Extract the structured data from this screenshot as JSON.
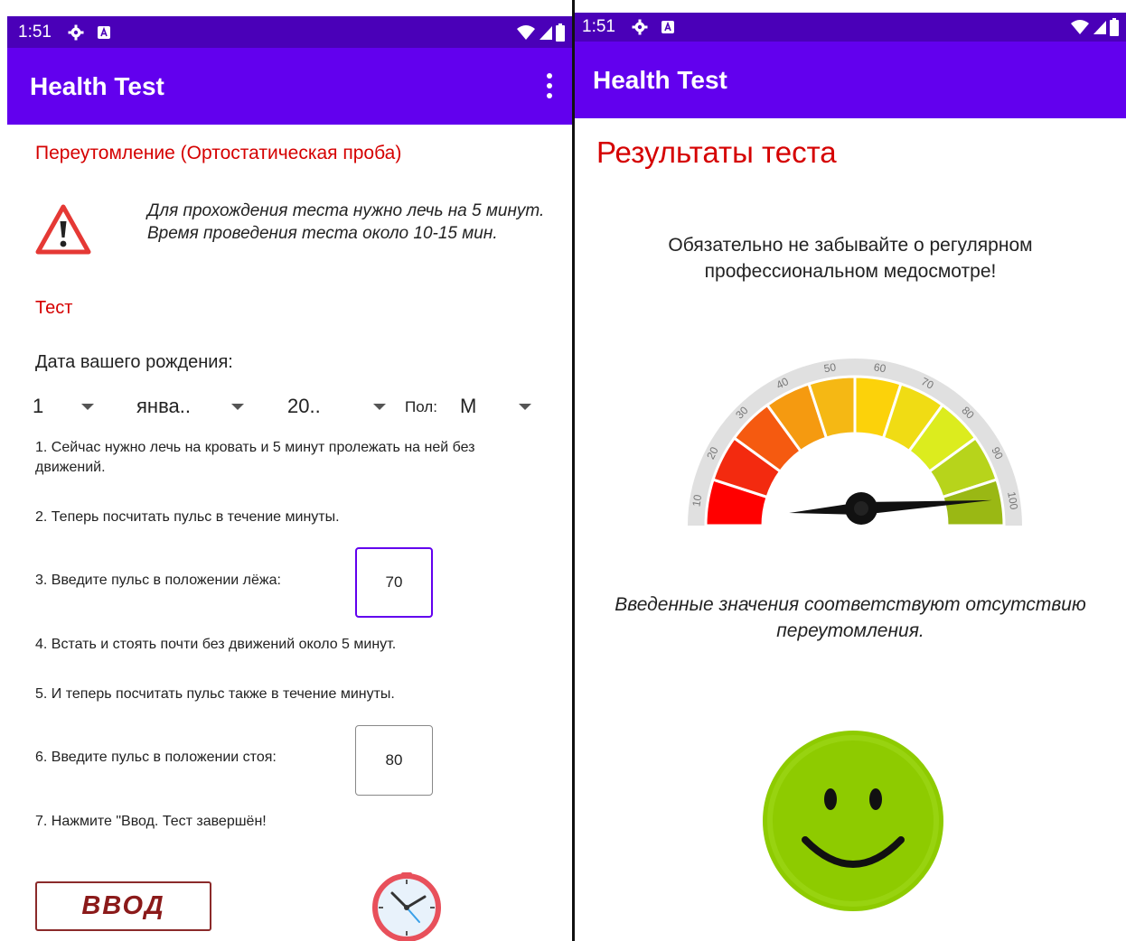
{
  "left_screen": {
    "status": {
      "time": "1:51"
    },
    "app_title": "Health Test",
    "test_title": "Переутомление (Ортостатическая проба)",
    "warning_text": "Для прохождения теста нужно лечь на 5 минут. Время проведения теста около 10-15 мин.",
    "section_label": "Тест",
    "dob_label": "Дата вашего рождения:",
    "day_value": "1",
    "month_value": "янва..",
    "year_value": "20..",
    "sex_label": "Пол:",
    "sex_value": "М",
    "steps": [
      "1. Сейчас нужно лечь на кровать и 5 минут пролежать на ней без движений.",
      "2. Теперь посчитать пульс в течение минуты.",
      "3. Введите пульс в положении лёжа:",
      "4. Встать и стоять почти без движений около 5 минут.",
      "5. И теперь посчитать пульс также в течение минуты.",
      "6. Введите пульс в положении стоя:",
      "7. Нажмите \"Ввод. Тест завершён!"
    ],
    "pulse_lying": "70",
    "pulse_standing": "80",
    "enter_button": "ВВОД",
    "icons": [
      "settings-icon",
      "keyboard-icon",
      "wifi-icon",
      "signal-icon",
      "battery-icon",
      "more-vert-icon",
      "warning-icon",
      "clock-icon"
    ]
  },
  "right_screen": {
    "status": {
      "time": "1:51"
    },
    "app_title": "Health Test",
    "results_title": "Результаты теста",
    "reminder": "Обязательно не забывайте о регулярном профессиональном медосмотре!",
    "gauge": {
      "ticks": [
        "10",
        "20",
        "30",
        "40",
        "50",
        "60",
        "70",
        "80",
        "90",
        "100"
      ],
      "value_fraction": 0.98,
      "segment_colors": [
        "#ff0000",
        "#f32a0f",
        "#f55a10",
        "#f59a10",
        "#f5b814",
        "#fcd20a",
        "#f0dc14",
        "#dcec1e",
        "#b7d41b",
        "#9ab814"
      ]
    },
    "result_text": "Введенные значения соответствуют отсутствию переутомления.",
    "smiley_color": "#8ecb00"
  }
}
